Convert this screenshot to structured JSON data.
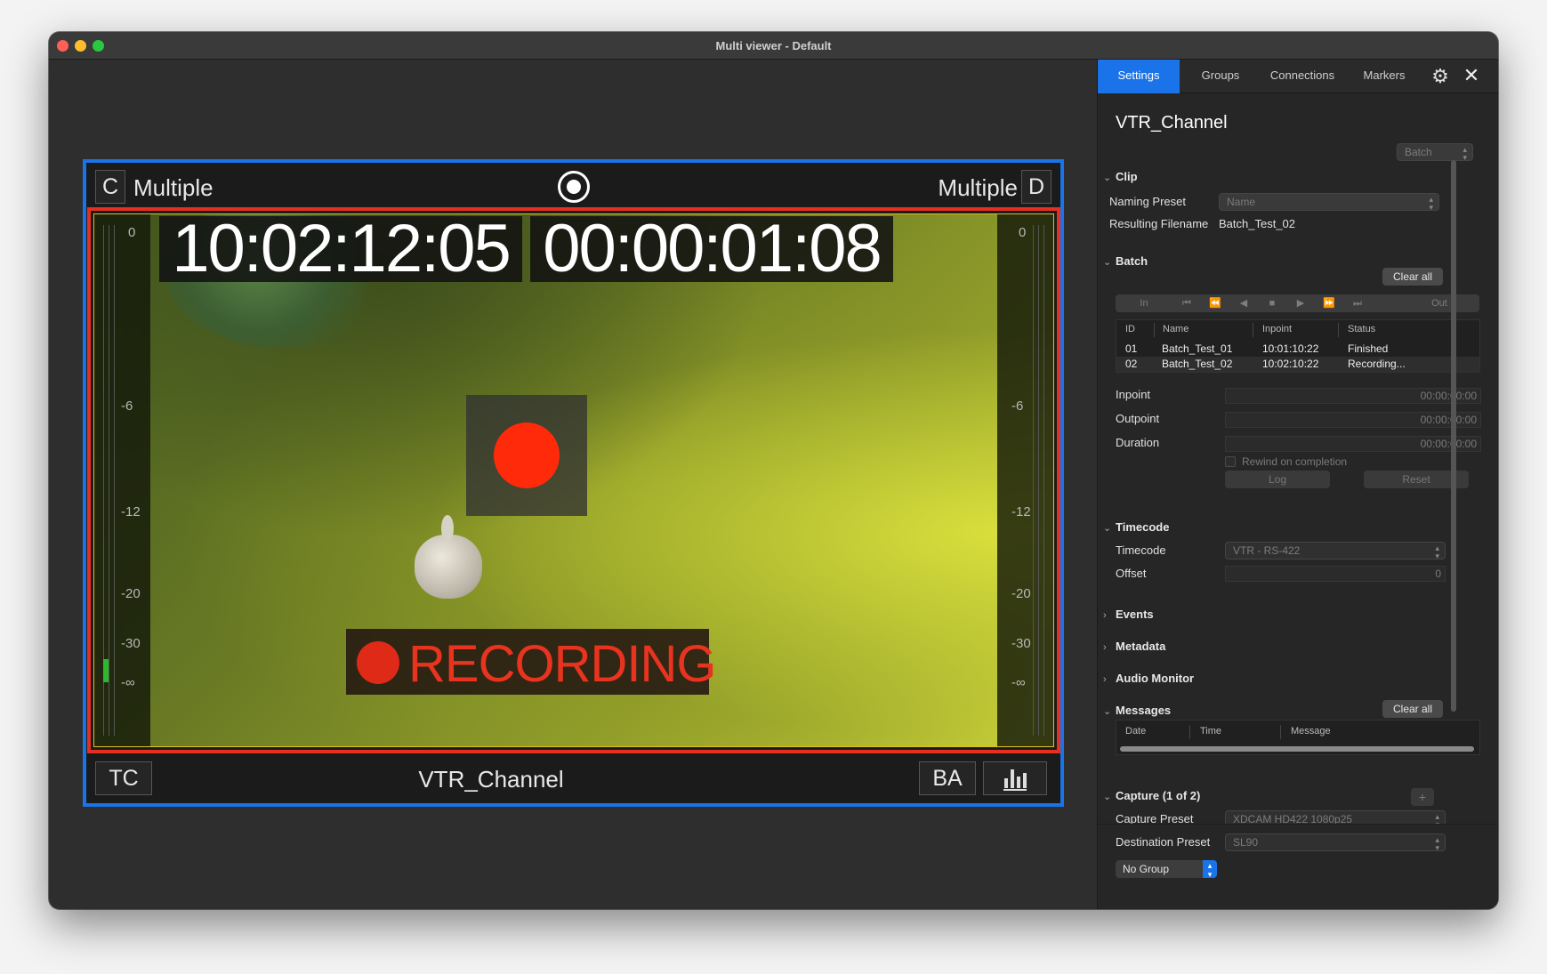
{
  "window": {
    "title": "Multi viewer - Default"
  },
  "viewer": {
    "top_left_letter": "C",
    "top_left_label": "Multiple",
    "top_right_label": "Multiple",
    "top_right_letter": "D",
    "timecode_left": "10:02:12:05",
    "timecode_right": "00:00:01:08",
    "meter_ticks": [
      "0",
      "-6",
      "-12",
      "-20",
      "-30",
      "-∞"
    ],
    "recording_label": "RECORDING",
    "bottom_left": "TC",
    "channel_name": "VTR_Channel",
    "bottom_right": "BA"
  },
  "panel": {
    "tabs": [
      "Settings",
      "Groups",
      "Connections",
      "Markers"
    ],
    "active_tab": "Settings",
    "title": "VTR_Channel",
    "mode_select": "Batch",
    "clip": {
      "heading": "Clip",
      "naming_preset_label": "Naming Preset",
      "naming_preset_value": "Name",
      "resulting_filename_label": "Resulting Filename",
      "resulting_filename_value": "Batch_Test_02"
    },
    "batch": {
      "heading": "Batch",
      "clear_all": "Clear all",
      "transport": {
        "in": "In",
        "out": "Out"
      },
      "columns": [
        "ID",
        "Name",
        "Inpoint",
        "Status"
      ],
      "rows": [
        {
          "id": "01",
          "name": "Batch_Test_01",
          "inpoint": "10:01:10:22",
          "status": "Finished"
        },
        {
          "id": "02",
          "name": "Batch_Test_02",
          "inpoint": "10:02:10:22",
          "status": "Recording..."
        }
      ],
      "inpoint_label": "Inpoint",
      "inpoint_value": "00:00:00:00",
      "outpoint_label": "Outpoint",
      "outpoint_value": "00:00:00:00",
      "duration_label": "Duration",
      "duration_value": "00:00:00:00",
      "rewind_label": "Rewind on completion",
      "log": "Log",
      "reset": "Reset"
    },
    "timecode": {
      "heading": "Timecode",
      "timecode_label": "Timecode",
      "timecode_value": "VTR - RS-422",
      "offset_label": "Offset",
      "offset_value": "0"
    },
    "events_heading": "Events",
    "metadata_heading": "Metadata",
    "audio_monitor_heading": "Audio Monitor",
    "messages": {
      "heading": "Messages",
      "clear_all": "Clear all",
      "columns": [
        "Date",
        "Time",
        "Message"
      ]
    },
    "capture": {
      "heading": "Capture (1 of 2)",
      "add": "+",
      "capture_preset_label": "Capture Preset",
      "capture_preset_value": "XDCAM HD422 1080p25",
      "destination_preset_label": "Destination Preset",
      "destination_preset_value": "SL90"
    },
    "group_select": "No Group"
  },
  "colors": {
    "accent": "#1a73e8",
    "record_red": "#ff2a0a",
    "frame_red": "#e53020"
  }
}
